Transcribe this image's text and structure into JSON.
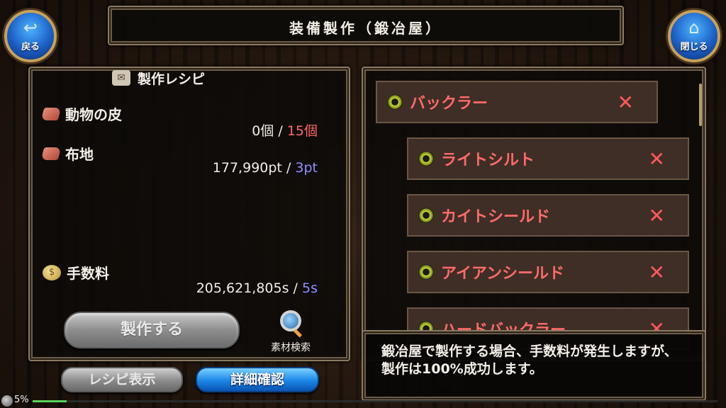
{
  "header": {
    "title": "装備製作（鍛冶屋）",
    "back_label": "戻る",
    "close_label": "閉じる",
    "back_icon": "return-arrow-icon",
    "close_icon": "home-icon"
  },
  "recipe_panel": {
    "title": "製作レシピ",
    "materials": [
      {
        "name": "動物の皮",
        "owned": "0個",
        "separator": "/",
        "required": "15個"
      },
      {
        "name": "布地",
        "owned": "177,990pt",
        "separator": "/",
        "required": "3pt"
      }
    ],
    "fee": {
      "name": "手数料",
      "owned": "205,621,805s",
      "separator": "/",
      "required": "5s"
    },
    "craft_button": "製作する",
    "search_label": "素材検索",
    "recipe_button": "レシピ表示",
    "detail_button": "詳細確認"
  },
  "recipe_tree": {
    "items": [
      {
        "name": "バックラー",
        "mark": "✕"
      },
      {
        "name": "ライトシルト",
        "mark": "✕"
      },
      {
        "name": "カイトシールド",
        "mark": "✕"
      },
      {
        "name": "アイアンシールド",
        "mark": "✕"
      },
      {
        "name": "ハードバックラー",
        "mark": "✕"
      }
    ]
  },
  "message": "鍛冶屋で製作する場合、手数料が発生しますが、製作は100%成功します。",
  "footer": {
    "progress_text": "5%",
    "progress": 0.05
  },
  "colors": {
    "required_insufficient": "#ff6a6a",
    "required_ok": "#8f8fff",
    "item_name": "#ff6b6b",
    "accent_blue": "#1a86e8"
  }
}
